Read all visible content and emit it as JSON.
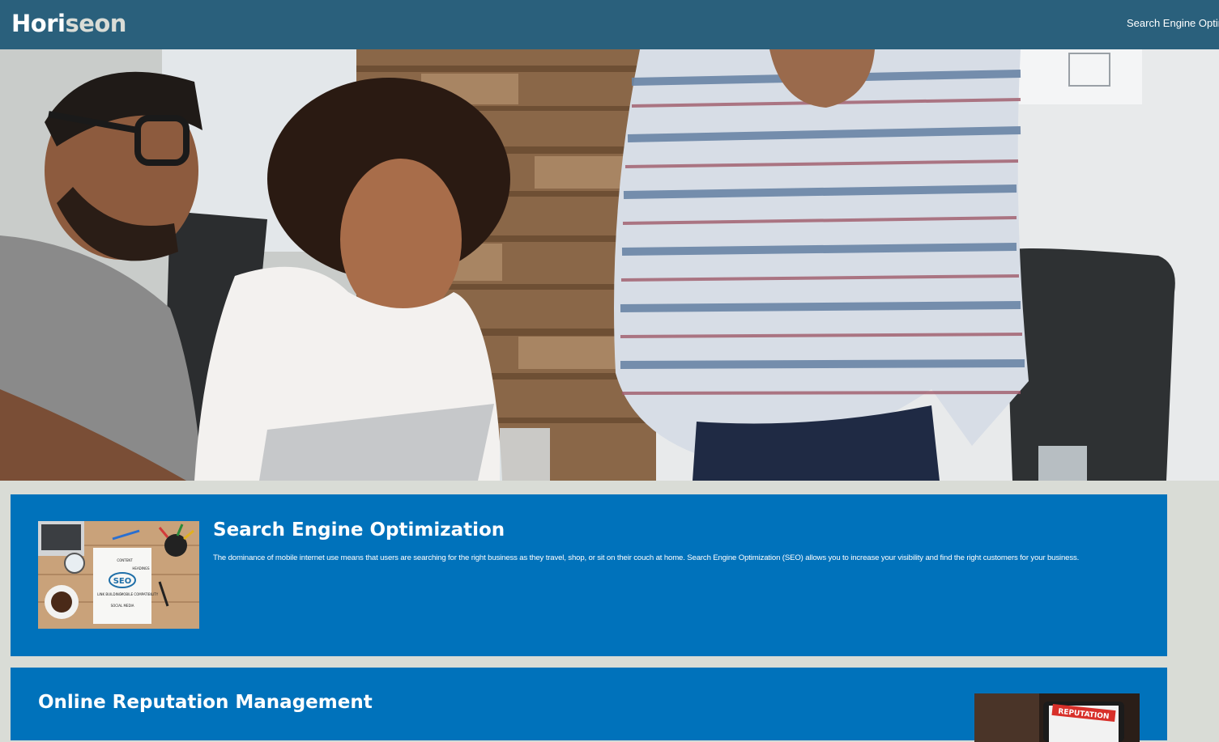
{
  "header": {
    "logo_primary": "Hori",
    "logo_secondary": "seon",
    "nav_items": [
      "Search Engine Optim"
    ]
  },
  "sections": {
    "seo": {
      "title": "Search Engine Optimization",
      "text": "The dominance of mobile internet use means that users are searching for the right business as they travel, shop, or sit on their couch at home. Search Engine Optimization (SEO) allows you to increase your visibility and find the right customers for your business.",
      "image_labels": [
        "SEO",
        "CONTENT",
        "HEADINGS",
        "MOBILE COMPATIBILITY",
        "SOCIAL MEDIA",
        "LINK BUILDING"
      ]
    },
    "orm": {
      "title": "Online Reputation Management",
      "image_label": "REPUTATION"
    }
  },
  "colors": {
    "header_bg": "#2a607c",
    "page_bg": "#d9dcd6",
    "card_bg": "#0072bb",
    "text": "#ffffff"
  }
}
